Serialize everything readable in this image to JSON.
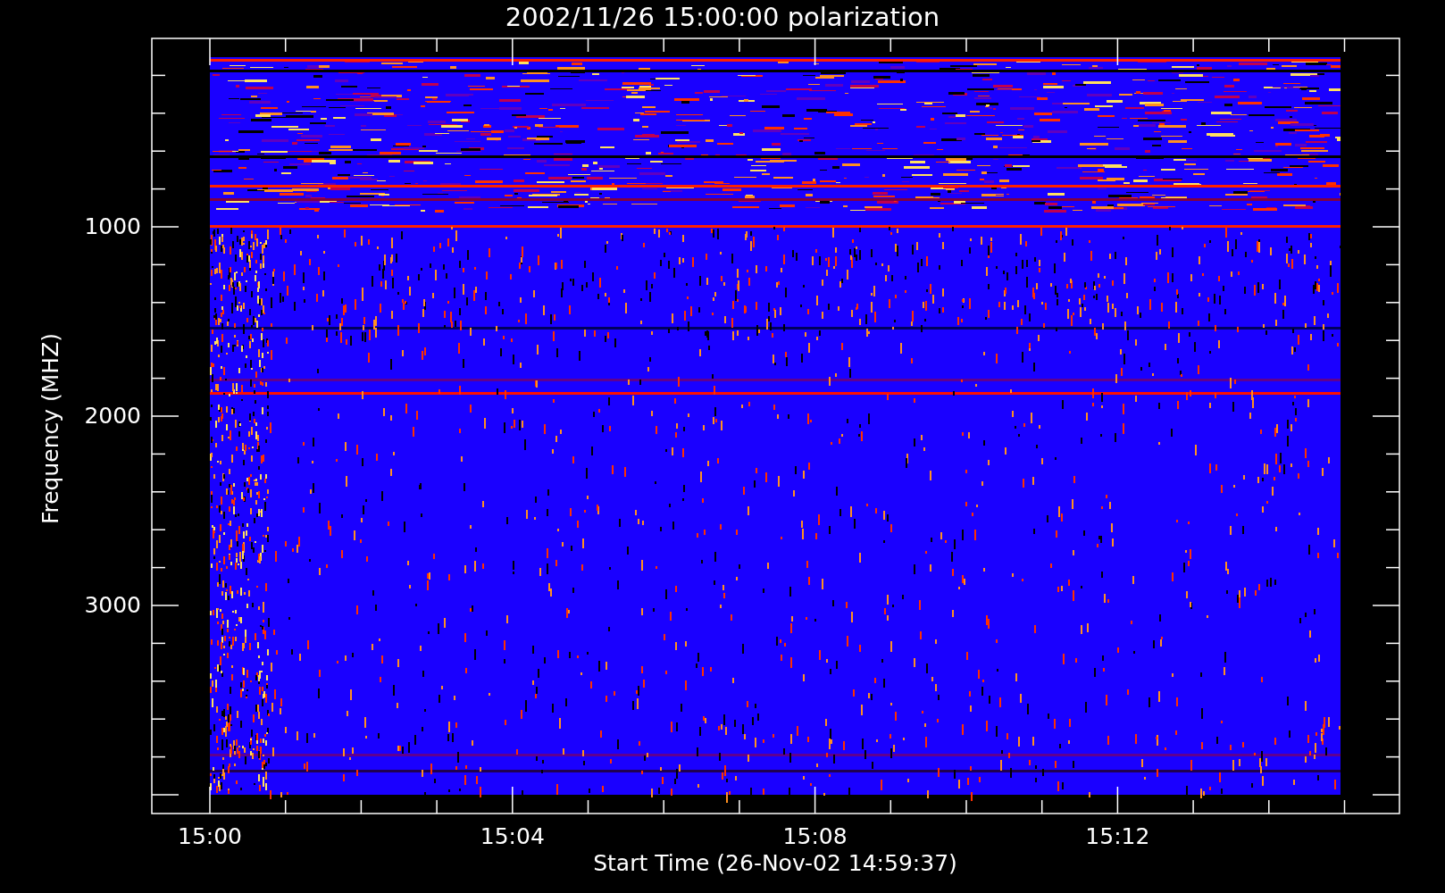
{
  "title": "2002/11/26 15:00:00 polarization",
  "y_axis": {
    "label": "Frequency (MHZ)",
    "ticks": [
      "1000",
      "2000",
      "3000"
    ]
  },
  "x_axis": {
    "label": "Start Time (26-Nov-02 14:59:37)",
    "ticks": [
      "15:00",
      "15:04",
      "15:08",
      "15:12"
    ]
  }
}
